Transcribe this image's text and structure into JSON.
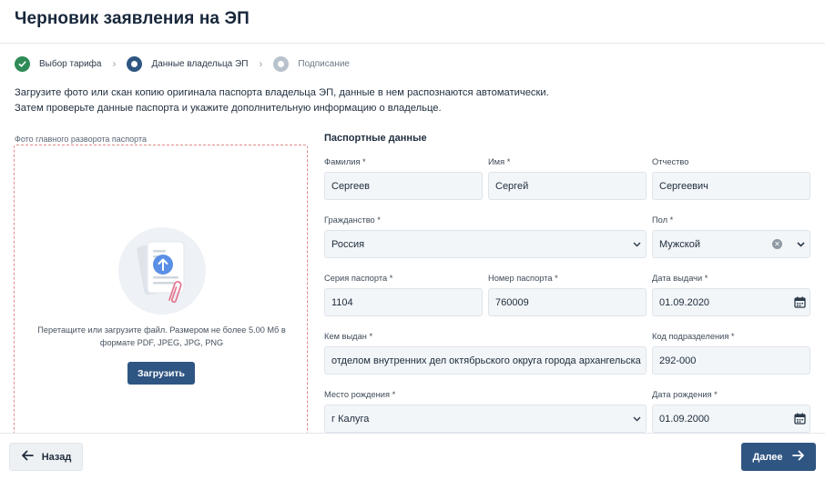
{
  "page": {
    "title": "Черновик заявления на ЭП"
  },
  "stepper": {
    "steps": [
      {
        "label": "Выбор тарифа",
        "state": "done"
      },
      {
        "label": "Данные владельца ЭП",
        "state": "current"
      },
      {
        "label": "Подписание",
        "state": "todo"
      }
    ]
  },
  "intro": {
    "line1": "Загрузите фото или скан копию оригинала паспорта владельца ЭП, данные в нем распознаются автоматически.",
    "line2": "Затем проверьте данные паспорта и укажите дополнительную информацию о владельце."
  },
  "upload": {
    "label": "Фото главного разворота паспорта",
    "hint_line1": "Перетащите или загрузите файл. Размером не более 5.00 Мб в",
    "hint_line2": "формате PDF, JPEG, JPG, PNG",
    "button": "Загрузить",
    "icon": "document-upload-icon"
  },
  "passport": {
    "section_title": "Паспортные данные",
    "surname": {
      "label": "Фамилия *",
      "value": "Сергеев"
    },
    "name": {
      "label": "Имя *",
      "value": "Сергей"
    },
    "patronymic": {
      "label": "Отчество",
      "value": "Сергеевич"
    },
    "citizenship": {
      "label": "Гражданство *",
      "value": "Россия"
    },
    "gender": {
      "label": "Пол *",
      "value": "Мужской"
    },
    "series": {
      "label": "Серия паспорта *",
      "value": "1104"
    },
    "number": {
      "label": "Номер паспорта *",
      "value": "760009"
    },
    "issue_date": {
      "label": "Дата выдачи *",
      "value": "01.09.2020"
    },
    "issued_by": {
      "label": "Кем выдан *",
      "value": "отделом внутренних дел октябрьского округа города архангельска"
    },
    "division_code": {
      "label": "Код подразделения *",
      "value": "292-000"
    },
    "birth_place": {
      "label": "Место рождения *",
      "value": "г Калуга"
    },
    "birth_date": {
      "label": "Дата рождения *",
      "value": "01.09.2000"
    }
  },
  "footer": {
    "back": "Назад",
    "next": "Далее"
  },
  "colors": {
    "primary": "#2f5582",
    "success": "#2e8b57",
    "dashed_border": "#e28a8a",
    "field_bg": "#f3f6f9"
  }
}
